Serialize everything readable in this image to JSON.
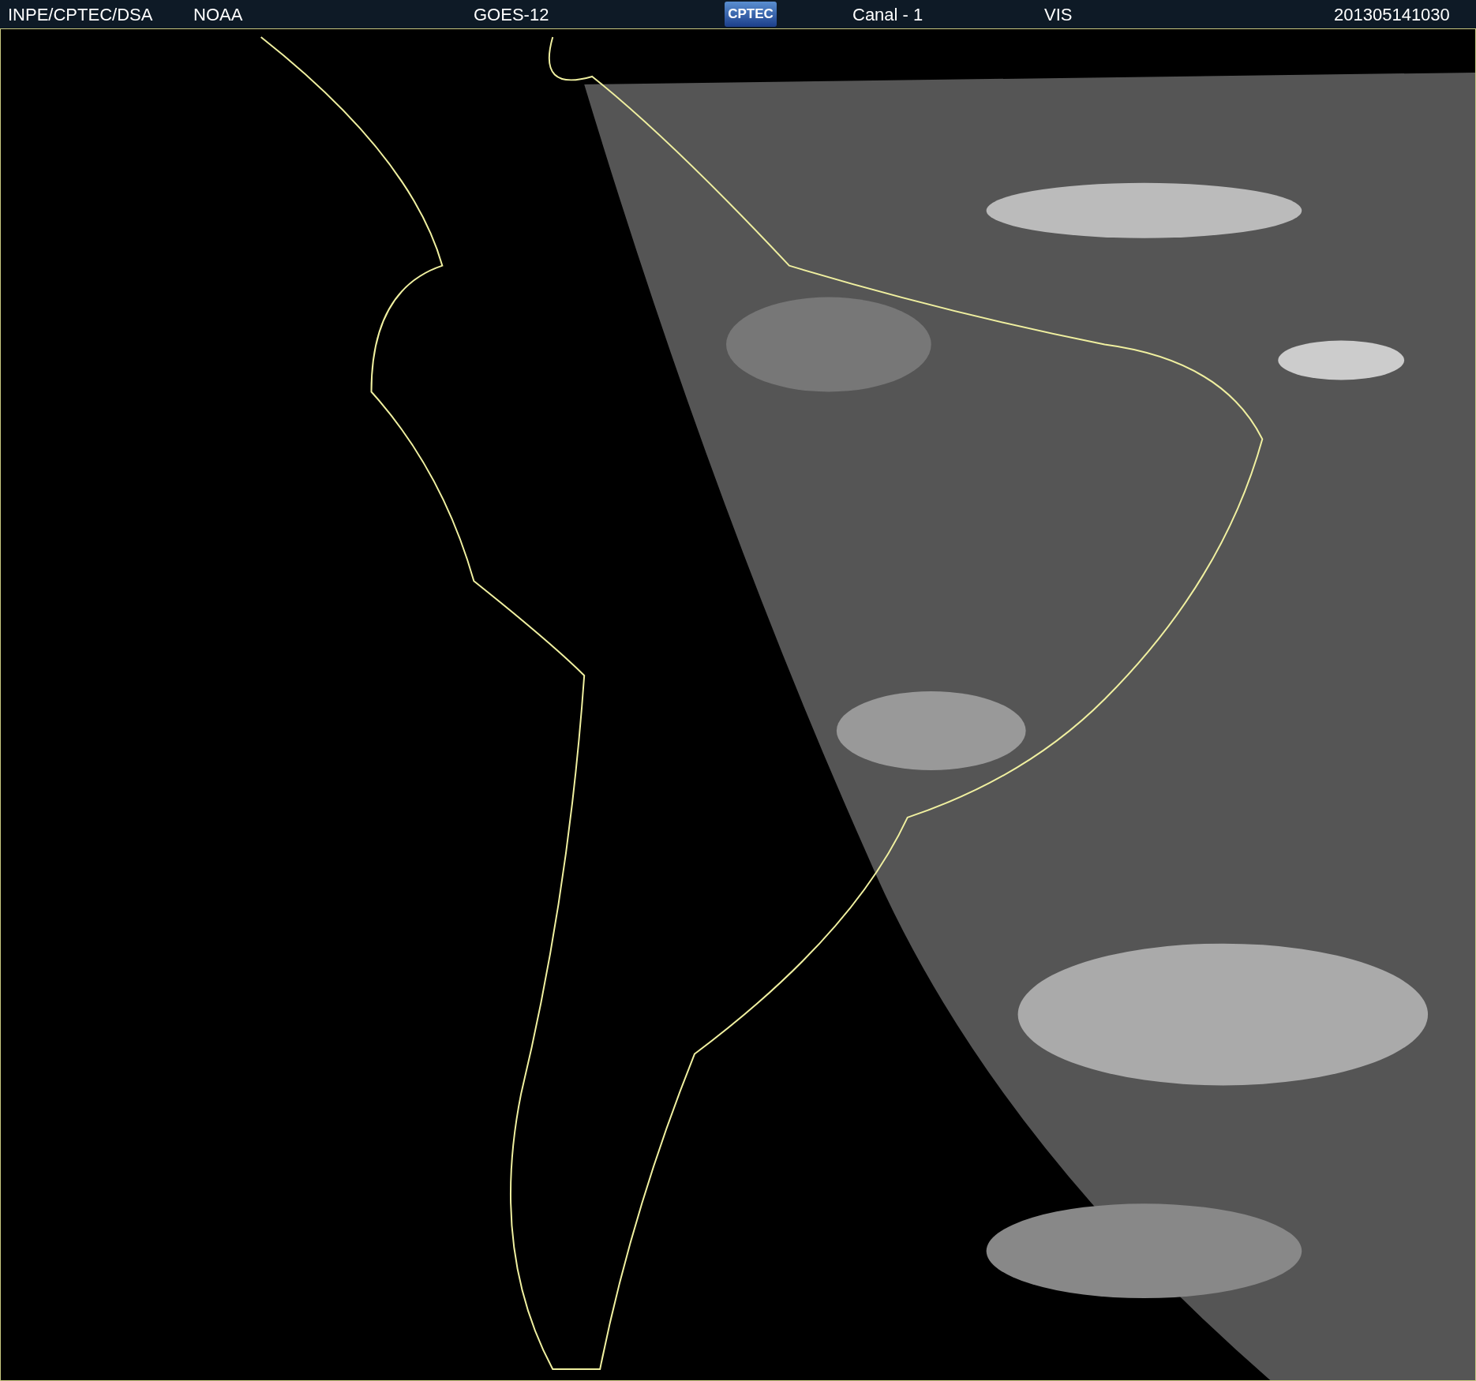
{
  "header": {
    "items": [
      {
        "kind": "text",
        "text": "INPE/CPTEC/DSA"
      },
      {
        "kind": "text",
        "text": "NOAA"
      },
      {
        "kind": "text",
        "text": "GOES-12"
      },
      {
        "kind": "logo",
        "text": "CPTEC"
      },
      {
        "kind": "text",
        "text": "Canal - 1"
      },
      {
        "kind": "text",
        "text": "VIS"
      },
      {
        "kind": "text",
        "text": "201305141030"
      }
    ]
  }
}
